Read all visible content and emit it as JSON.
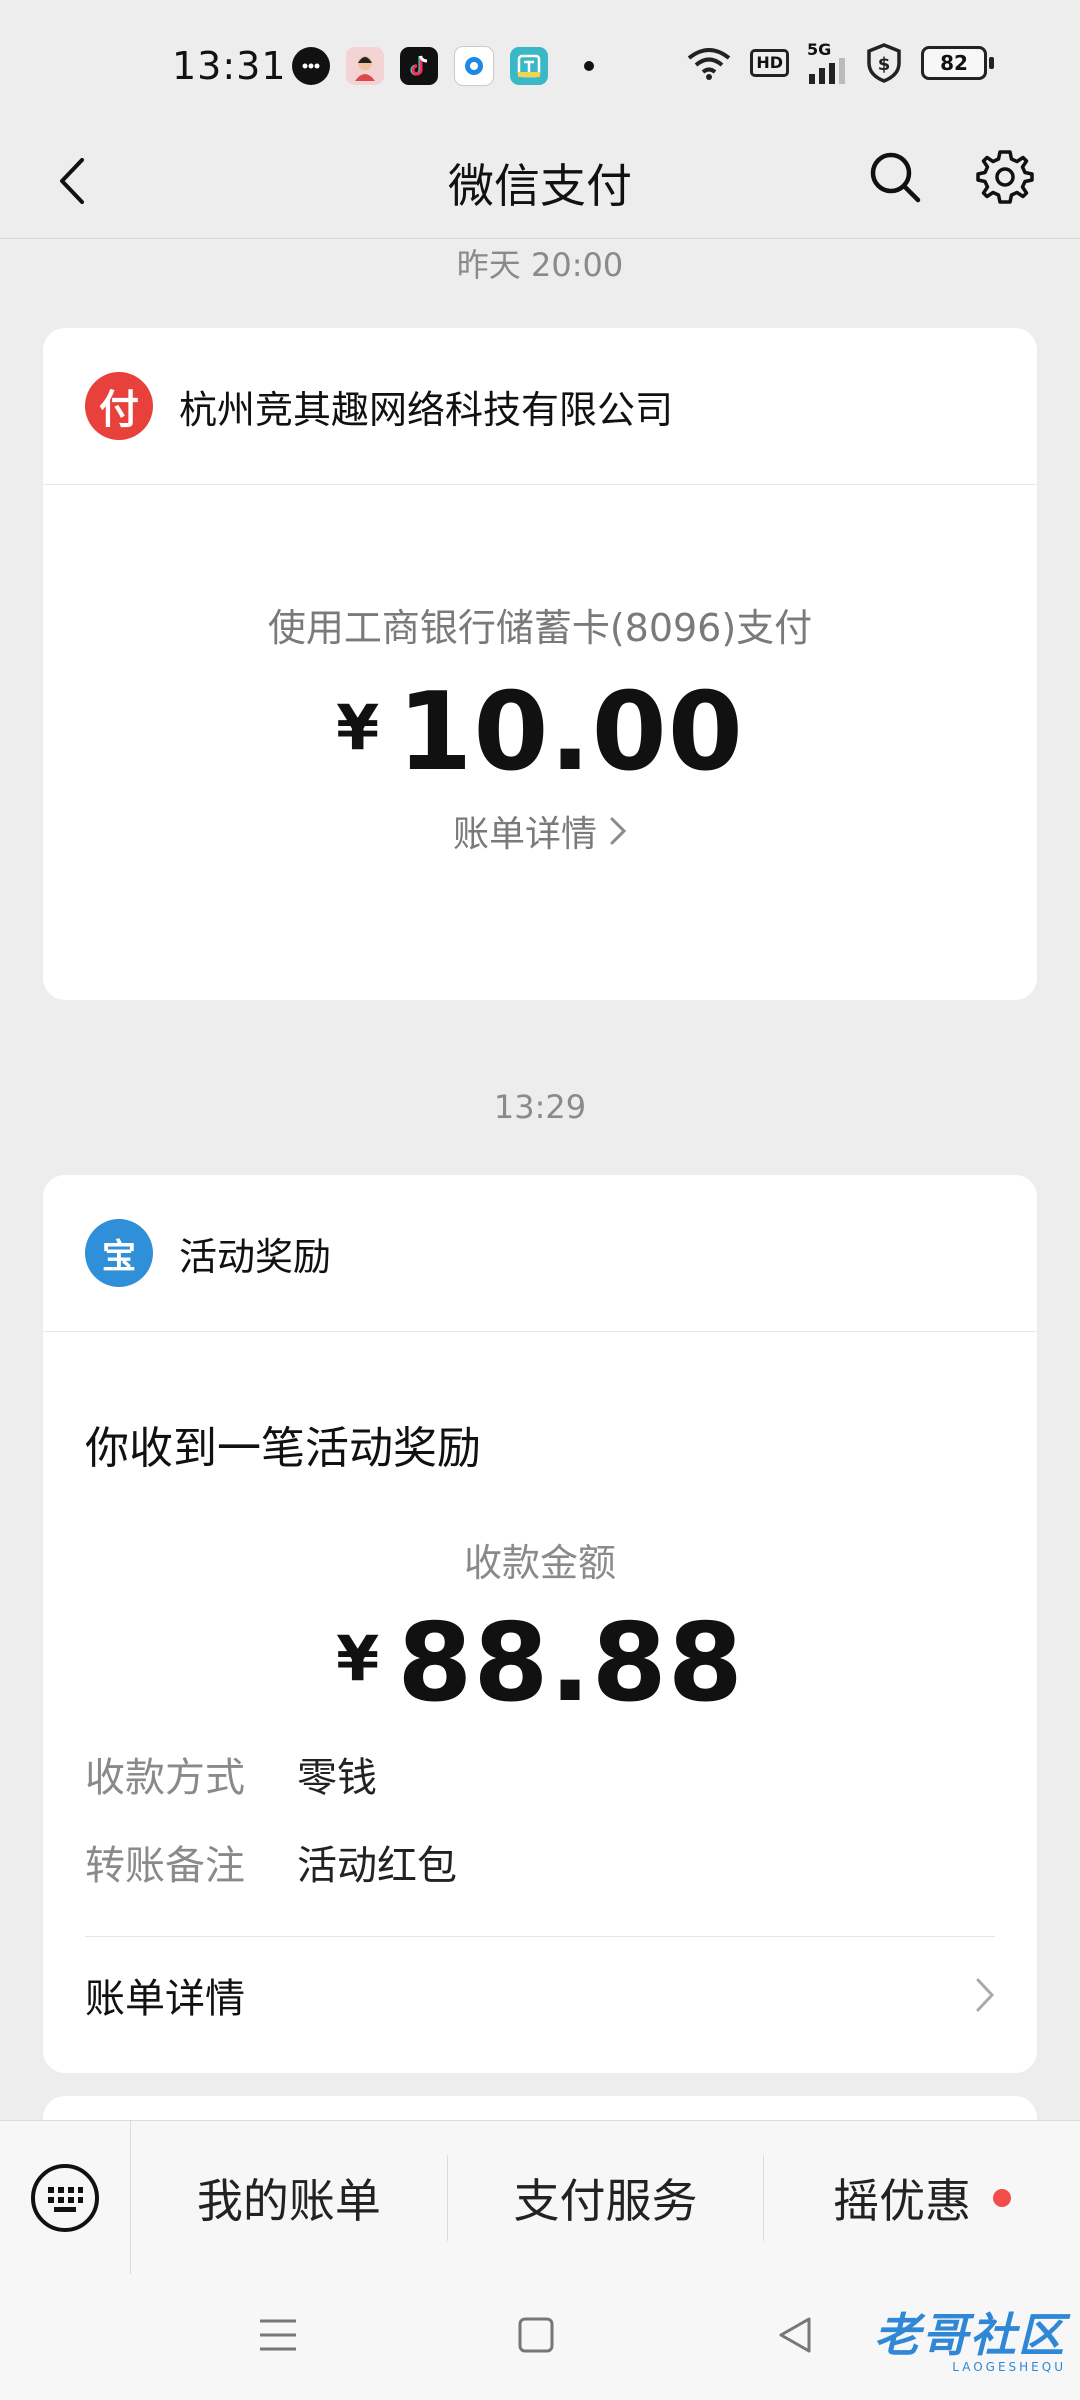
{
  "status_bar": {
    "time": "13:31",
    "battery": "82",
    "hd": "HD",
    "network": "5G"
  },
  "nav": {
    "title": "微信支付"
  },
  "timestamps": {
    "first": "昨天 20:00",
    "second": "13:29"
  },
  "payment_card": {
    "merchant_name": "杭州竞其趣网络科技有限公司",
    "merchant_logo_glyph": "付",
    "description": "使用工商银行储蓄卡(8096)支付",
    "currency_symbol": "¥",
    "amount": "10.00",
    "detail_link": "账单详情"
  },
  "reward_card": {
    "sender_name": "活动奖励",
    "logo_glyph": "宝",
    "headline": "你收到一笔活动奖励",
    "amount_label": "收款金额",
    "currency_symbol": "¥",
    "amount": "88.88",
    "rows": [
      {
        "key": "收款方式",
        "value": "零钱"
      },
      {
        "key": "转账备注",
        "value": "活动红包"
      }
    ],
    "bill_detail": "账单详情"
  },
  "bottom_menu": {
    "items": [
      "我的账单",
      "支付服务",
      "摇优惠"
    ]
  },
  "watermark": {
    "text": "老哥社区",
    "sub": "LAOGESHEQU"
  },
  "colors": {
    "background": "#ededed",
    "card": "#ffffff",
    "merchant_logo": "#e8403b",
    "reward_logo": "#2f8fd8",
    "badge_red": "#f24c4c"
  }
}
